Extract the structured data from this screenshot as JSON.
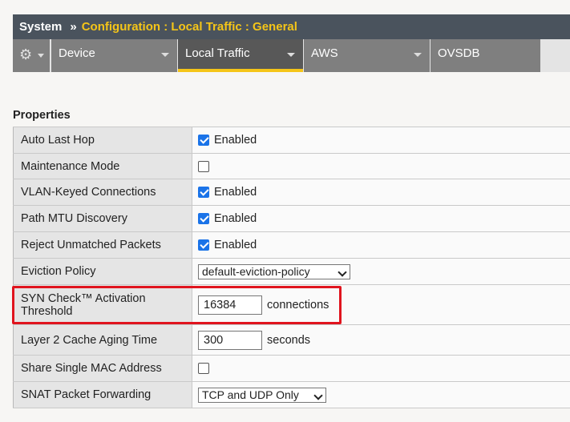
{
  "header": {
    "system": "System",
    "separator": "»",
    "path": "Configuration : Local Traffic : General"
  },
  "tabs": [
    {
      "label": "Device",
      "active": false
    },
    {
      "label": "Local Traffic",
      "active": true
    },
    {
      "label": "AWS",
      "active": false
    },
    {
      "label": "OVSDB",
      "active": false
    }
  ],
  "section_title": "Properties",
  "rows": {
    "auto_last_hop": {
      "label": "Auto Last Hop",
      "checked": true,
      "text": "Enabled"
    },
    "maintenance_mode": {
      "label": "Maintenance Mode",
      "checked": false
    },
    "vlan_keyed": {
      "label": "VLAN-Keyed Connections",
      "checked": true,
      "text": "Enabled"
    },
    "path_mtu": {
      "label": "Path MTU Discovery",
      "checked": true,
      "text": "Enabled"
    },
    "reject_unmatched": {
      "label": "Reject Unmatched Packets",
      "checked": true,
      "text": "Enabled"
    },
    "eviction_policy": {
      "label": "Eviction Policy",
      "value": "default-eviction-policy"
    },
    "syn_check": {
      "label_line1": "SYN Check™ Activation",
      "label_line2": "Threshold",
      "value": "16384",
      "unit": "connections"
    },
    "l2_cache": {
      "label": "Layer 2 Cache Aging Time",
      "value": "300",
      "unit": "seconds"
    },
    "share_mac": {
      "label": "Share Single MAC Address",
      "checked": false
    },
    "snat_forwarding": {
      "label": "SNAT Packet Forwarding",
      "value": "TCP and UDP Only"
    }
  },
  "colors": {
    "header_bg": "#4a535d",
    "path_text": "#f5c518",
    "active_tab_underline": "#f5c518",
    "highlight_box": "#e0141e",
    "checkbox_checked": "#1a73e8"
  }
}
